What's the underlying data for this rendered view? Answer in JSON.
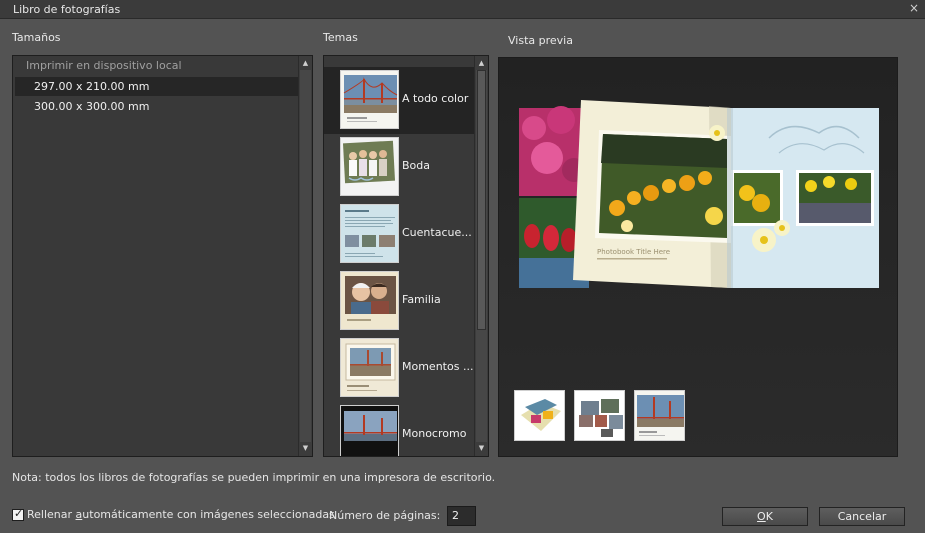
{
  "window": {
    "title": "Libro de fotografías",
    "close_glyph": "×"
  },
  "sizes": {
    "label": "Tamaños",
    "group_header": "Imprimir en dispositivo local",
    "items": [
      {
        "label": "297.00 x 210.00  mm",
        "selected": true
      },
      {
        "label": "300.00 x 300.00  mm",
        "selected": false
      }
    ]
  },
  "themes": {
    "label": "Temas",
    "items": [
      {
        "label": "A todo color",
        "selected": true,
        "icon": "golden-gate-thumbnail"
      },
      {
        "label": "Boda",
        "selected": false,
        "icon": "wedding-thumbnail"
      },
      {
        "label": "Cuentacue...",
        "selected": false,
        "icon": "storybook-thumbnail"
      },
      {
        "label": "Familia",
        "selected": false,
        "icon": "family-thumbnail"
      },
      {
        "label": "Momentos ...",
        "selected": false,
        "icon": "moments-thumbnail"
      },
      {
        "label": "Monocromo",
        "selected": false,
        "icon": "monochrome-thumbnail"
      }
    ]
  },
  "preview": {
    "label": "Vista previa",
    "book_title_text": "Photobook Title Here",
    "thumbnails": [
      "cover-thumbnail",
      "spread-thumbnail",
      "page-thumbnail"
    ]
  },
  "note": "Nota: todos los libros de fotografías se pueden imprimir en una impresora de escritorio.",
  "autofill": {
    "pre": "Rellenar ",
    "underlined": "a",
    "post": "utomáticamente con imágenes seleccionadas",
    "checked": true
  },
  "pages": {
    "label": "Número de páginas:",
    "value": "2"
  },
  "buttons": {
    "ok_underlined": "O",
    "ok_rest": "K",
    "cancel": "Cancelar"
  },
  "colors": {
    "background": "#535353",
    "panel": "#393939",
    "selection": "#262626"
  }
}
